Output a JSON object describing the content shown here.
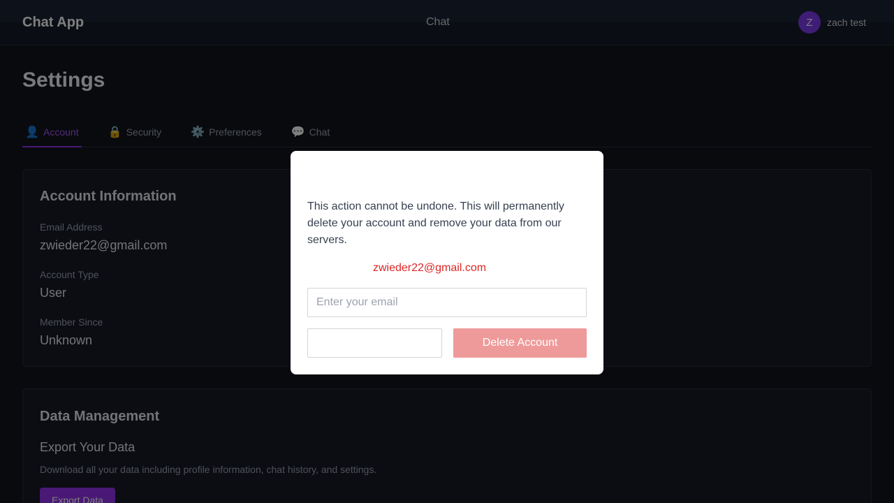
{
  "header": {
    "brand": "Chat App",
    "nav_chat": "Chat",
    "avatar_initial": "Z",
    "user_name": "zach test"
  },
  "page": {
    "title": "Settings"
  },
  "tabs": [
    {
      "icon": "👤",
      "icon_name": "user-icon",
      "label": "Account",
      "active": true
    },
    {
      "icon": "🔒",
      "icon_name": "lock-icon",
      "label": "Security",
      "active": false
    },
    {
      "icon": "⚙️",
      "icon_name": "gear-icon",
      "label": "Preferences",
      "active": false
    },
    {
      "icon": "💬",
      "icon_name": "chat-bubble-icon",
      "label": "Chat",
      "active": false
    }
  ],
  "account": {
    "title": "Account Information",
    "email_label": "Email Address",
    "email_value": "zwieder22@gmail.com",
    "type_label": "Account Type",
    "type_value": "User",
    "since_label": "Member Since",
    "since_value": "Unknown"
  },
  "data_management": {
    "title": "Data Management",
    "export_title": "Export Your Data",
    "export_desc": "Download all your data including profile information, chat history, and settings.",
    "export_button": "Export Data"
  },
  "modal": {
    "message": "This action cannot be undone. This will permanently delete your account and remove your data from our servers.",
    "confirm_email": "zwieder22@gmail.com",
    "input_placeholder": "Enter your email",
    "input_value": "",
    "cancel_label": "",
    "delete_label": "Delete Account"
  },
  "colors": {
    "accent": "#9333ea",
    "danger_text": "#dc2626",
    "danger_button_disabled": "#ef9a9a"
  }
}
